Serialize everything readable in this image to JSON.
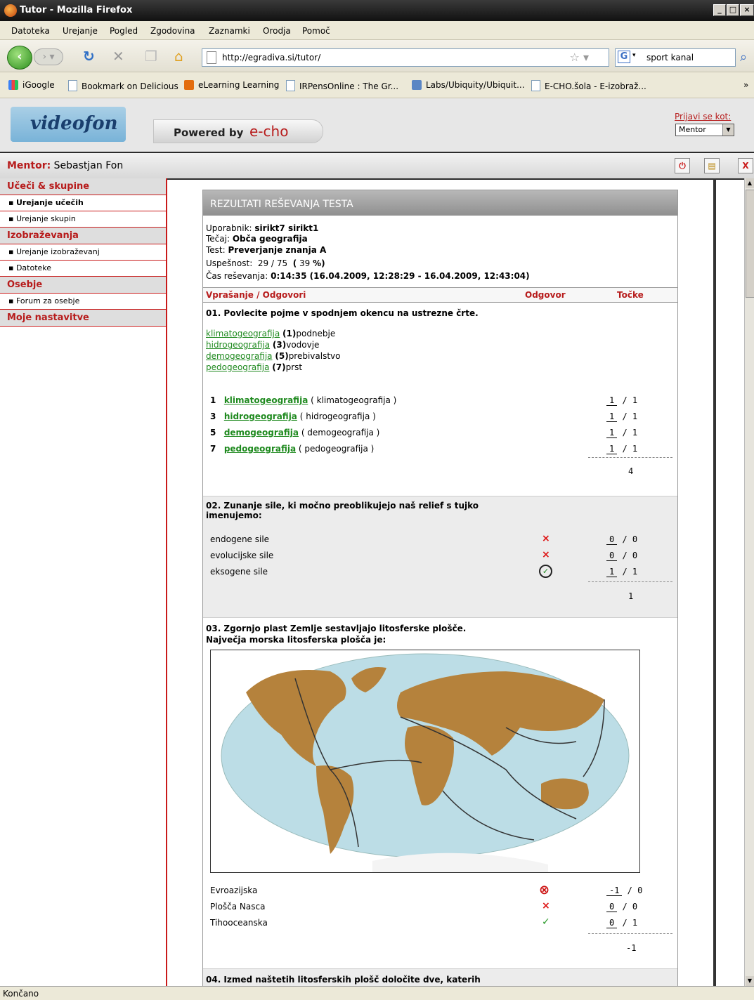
{
  "window": {
    "title": "Tutor - Mozilla Firefox"
  },
  "menu": [
    "Datoteka",
    "Urejanje",
    "Pogled",
    "Zgodovina",
    "Zaznamki",
    "Orodja",
    "Pomoč"
  ],
  "nav": {
    "url": "http://egradiva.si/tutor/",
    "search_value": "sport kanal"
  },
  "bookmarks": [
    "iGoogle",
    "Bookmark on Delicious",
    "eLearning Learning",
    "IRPensOnline : The Gr...",
    "Labs/Ubiquity/Ubiquit...",
    "E-CHO.šola - E-izobraž..."
  ],
  "header": {
    "logo": "videofon",
    "powered": "Powered by",
    "echo": "e-cho",
    "login_label": "Prijavi se kot:",
    "role": "Mentor"
  },
  "mentor": {
    "label": "Mentor:",
    "name": "Sebastjan Fon"
  },
  "sidebar": {
    "sec1": "Učeči & skupine",
    "s1i1": "Urejanje učečih",
    "s1i2": "Urejanje skupin",
    "sec2": "Izobraževanja",
    "s2i1": "Urejanje izobraževanj",
    "s2i2": "Datoteke",
    "sec3": "Osebje",
    "s3i1": "Forum za osebje",
    "sec4": "Moje nastavitve"
  },
  "panel": {
    "title": "REZULTATI REŠEVANJA TESTA",
    "user_label": "Uporabnik:",
    "user": "sirikt7 sirikt1",
    "course_label": "Tečaj:",
    "course": "Obča geografija",
    "test_label": "Test:",
    "test": "Preverjanje znanja A",
    "success_label": "Uspešnost:",
    "success": "29 / 75",
    "pct_open": "(",
    "pct": "39",
    "pct_sign": "%)",
    "time_label": "Čas reševanja:",
    "time": "0:14:35 (16.04.2009, 12:28:29 - 16.04.2009, 12:43:04)",
    "col_q": "Vprašanje / Odgovori",
    "col_a": "Odgovor",
    "col_p": "Točke"
  },
  "q1": {
    "text": "01. Povlecite pojme v spodnjem okencu na ustrezne črte.",
    "pairs": [
      {
        "term": "klimatogeografija",
        "num": "(1)",
        "desc": "podnebje"
      },
      {
        "term": "hidrogeografija",
        "num": "(3)",
        "desc": "vodovje"
      },
      {
        "term": "demogeografija",
        "num": "(5)",
        "desc": "prebivalstvo"
      },
      {
        "term": "pedogeografija",
        "num": "(7)",
        "desc": "prst"
      }
    ],
    "rows": [
      {
        "n": "1",
        "answer": "klimatogeografija",
        "correct": "( klimatogeografija )",
        "got": "1",
        "max": "1"
      },
      {
        "n": "3",
        "answer": "hidrogeografija",
        "correct": "( hidrogeografija )",
        "got": "1",
        "max": "1"
      },
      {
        "n": "5",
        "answer": "demogeografija",
        "correct": "( demogeografija )",
        "got": "1",
        "max": "1"
      },
      {
        "n": "7",
        "answer": "pedogeografija",
        "correct": "( pedogeografija )",
        "got": "1",
        "max": "1"
      }
    ],
    "total": "4"
  },
  "q2": {
    "line1": "02. Zunanje sile, ki močno preoblikujejo naš relief s tujko",
    "line2": "imenujemo:",
    "rows": [
      {
        "text": "endogene sile",
        "mark": "×",
        "got": "0",
        "max": "0"
      },
      {
        "text": "evolucijske sile",
        "mark": "×",
        "got": "0",
        "max": "0"
      },
      {
        "text": "eksogene sile",
        "mark": "✓",
        "got": "1",
        "max": "1"
      }
    ],
    "total": "1"
  },
  "q3": {
    "line1": "03. Zgornjo plast Zemlje sestavljajo litosferske plošče.",
    "line2": "Največja morska litosferska plošča je:",
    "rows": [
      {
        "text": "Evroazijska",
        "mark": "⊗",
        "got": "-1",
        "max": "0"
      },
      {
        "text": "Plošča Nasca",
        "mark": "×",
        "got": "0",
        "max": "0"
      },
      {
        "text": "Tihooceanska",
        "mark": "✓",
        "got": "0",
        "max": "1"
      }
    ],
    "total": "-1"
  },
  "q4": {
    "text": "04. Izmed naštetih litosferskih plošč določite dve, katerih"
  },
  "status": "Končano"
}
